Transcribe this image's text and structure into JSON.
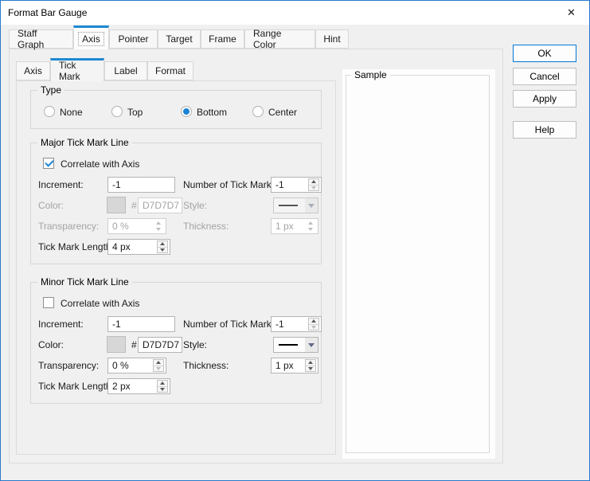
{
  "window": {
    "title": "Format Bar Gauge",
    "close_icon": "✕"
  },
  "main_tabs": [
    {
      "label": "Staff Graph"
    },
    {
      "label": "Axis"
    },
    {
      "label": "Pointer"
    },
    {
      "label": "Target"
    },
    {
      "label": "Frame"
    },
    {
      "label": "Range Color"
    },
    {
      "label": "Hint"
    }
  ],
  "active_main_tab": "Axis",
  "sub_tabs": [
    {
      "label": "Axis"
    },
    {
      "label": "Tick Mark"
    },
    {
      "label": "Label"
    },
    {
      "label": "Format"
    }
  ],
  "active_sub_tab": "Tick Mark",
  "type_group": {
    "title": "Type",
    "selected": "Bottom",
    "options": [
      {
        "label": "None"
      },
      {
        "label": "Top"
      },
      {
        "label": "Bottom"
      },
      {
        "label": "Center"
      }
    ]
  },
  "major": {
    "title": "Major Tick Mark Line",
    "correlate": {
      "label": "Correlate with Axis",
      "checked": true
    },
    "increment": {
      "label": "Increment:",
      "value": "-1"
    },
    "number_of_tick_marks": {
      "label": "Number of Tick Marks:",
      "value": "-1"
    },
    "color": {
      "label": "Color:",
      "hash": "#",
      "value": "D7D7D7",
      "swatch": "#D7D7D7",
      "enabled": false
    },
    "style": {
      "label": "Style:",
      "enabled": false
    },
    "transparency": {
      "label": "Transparency:",
      "value": "0 %",
      "enabled": false
    },
    "thickness": {
      "label": "Thickness:",
      "value": "1 px",
      "enabled": false
    },
    "tick_mark_length": {
      "label": "Tick Mark Length:",
      "value": "4 px",
      "enabled": true
    }
  },
  "minor": {
    "title": "Minor Tick Mark Line",
    "correlate": {
      "label": "Correlate with Axis",
      "checked": false
    },
    "increment": {
      "label": "Increment:",
      "value": "-1"
    },
    "number_of_tick_marks": {
      "label": "Number of Tick Marks:",
      "value": "-1"
    },
    "color": {
      "label": "Color:",
      "hash": "#",
      "value": "D7D7D7",
      "swatch": "#D7D7D7",
      "enabled": true
    },
    "style": {
      "label": "Style:",
      "enabled": true
    },
    "transparency": {
      "label": "Transparency:",
      "value": "0 %",
      "enabled": true
    },
    "thickness": {
      "label": "Thickness:",
      "value": "1 px",
      "enabled": true
    },
    "tick_mark_length": {
      "label": "Tick Mark Length:",
      "value": "2 px",
      "enabled": true
    }
  },
  "sample_group": {
    "title": "Sample"
  },
  "action_buttons": [
    {
      "label": "OK",
      "default": true
    },
    {
      "label": "Cancel"
    },
    {
      "label": "Apply"
    },
    {
      "label": "Help"
    }
  ],
  "colors": {
    "accent": "#1a83d6",
    "window_border": "#2979cc",
    "tick_color_value": "#D7D7D7"
  }
}
